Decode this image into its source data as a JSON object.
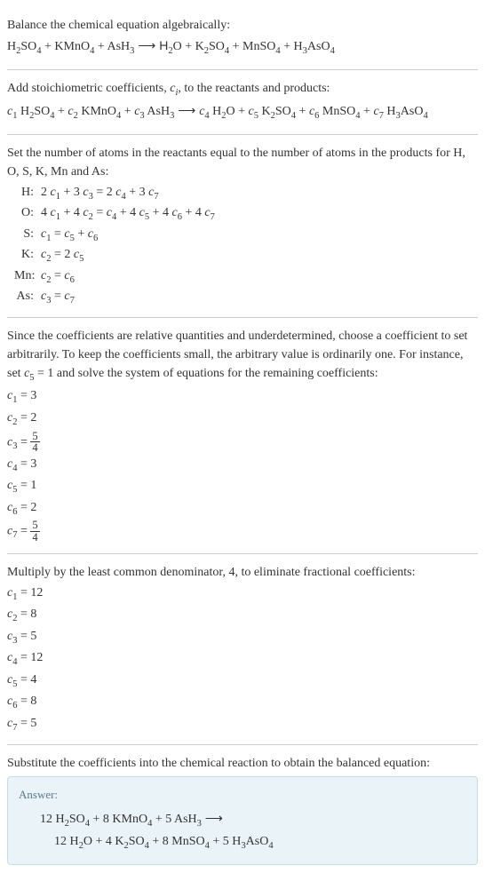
{
  "section1": {
    "line1": "Balance the chemical equation algebraically:",
    "line2_parts": [
      "H",
      "2",
      "SO",
      "4",
      " + KMnO",
      "4",
      " + AsH",
      "3",
      "  ⟶  H",
      "2",
      "O + K",
      "2",
      "SO",
      "4",
      " + MnSO",
      "4",
      " + H",
      "3",
      "AsO",
      "4"
    ]
  },
  "section2": {
    "line1_pre": "Add stoichiometric coefficients, ",
    "line1_ci": "c",
    "line1_i": "i",
    "line1_post": ", to the reactants and products:",
    "line2_parts": [
      "c",
      "1",
      " H",
      "2",
      "SO",
      "4",
      " + ",
      "c",
      "2",
      " KMnO",
      "4",
      " + ",
      "c",
      "3",
      " AsH",
      "3",
      "  ⟶  ",
      "c",
      "4",
      " H",
      "2",
      "O + ",
      "c",
      "5",
      " K",
      "2",
      "SO",
      "4",
      " + ",
      "c",
      "6",
      " MnSO",
      "4",
      " + ",
      "c",
      "7",
      " H",
      "3",
      "AsO",
      "4"
    ]
  },
  "section3": {
    "intro": "Set the number of atoms in the reactants equal to the number of atoms in the products for H, O, S, K, Mn and As:",
    "rows": [
      {
        "label": "H:",
        "eq_parts": [
          "2 ",
          "c",
          "1",
          " + 3 ",
          "c",
          "3",
          " = 2 ",
          "c",
          "4",
          " + 3 ",
          "c",
          "7"
        ]
      },
      {
        "label": "O:",
        "eq_parts": [
          "4 ",
          "c",
          "1",
          " + 4 ",
          "c",
          "2",
          " = ",
          "c",
          "4",
          " + 4 ",
          "c",
          "5",
          " + 4 ",
          "c",
          "6",
          " + 4 ",
          "c",
          "7"
        ]
      },
      {
        "label": "S:",
        "eq_parts": [
          "c",
          "1",
          " = ",
          "c",
          "5",
          " + ",
          "c",
          "6"
        ]
      },
      {
        "label": "K:",
        "eq_parts": [
          "c",
          "2",
          " = 2 ",
          "c",
          "5"
        ]
      },
      {
        "label": "Mn:",
        "eq_parts": [
          "c",
          "2",
          " = ",
          "c",
          "6"
        ]
      },
      {
        "label": "As:",
        "eq_parts": [
          "c",
          "3",
          " = ",
          "c",
          "7"
        ]
      }
    ]
  },
  "section4": {
    "intro_parts": [
      "Since the coefficients are relative quantities and underdetermined, choose a coefficient to set arbitrarily. To keep the coefficients small, the arbitrary value is ordinarily one. For instance, set ",
      "c",
      "5",
      " = 1 and solve the system of equations for the remaining coefficients:"
    ],
    "coeffs": [
      {
        "var": "c",
        "sub": "1",
        "val": "3",
        "frac": null
      },
      {
        "var": "c",
        "sub": "2",
        "val": "2",
        "frac": null
      },
      {
        "var": "c",
        "sub": "3",
        "val": null,
        "frac": {
          "num": "5",
          "den": "4"
        }
      },
      {
        "var": "c",
        "sub": "4",
        "val": "3",
        "frac": null
      },
      {
        "var": "c",
        "sub": "5",
        "val": "1",
        "frac": null
      },
      {
        "var": "c",
        "sub": "6",
        "val": "2",
        "frac": null
      },
      {
        "var": "c",
        "sub": "7",
        "val": null,
        "frac": {
          "num": "5",
          "den": "4"
        }
      }
    ]
  },
  "section5": {
    "intro": "Multiply by the least common denominator, 4, to eliminate fractional coefficients:",
    "coeffs": [
      {
        "var": "c",
        "sub": "1",
        "val": "12"
      },
      {
        "var": "c",
        "sub": "2",
        "val": "8"
      },
      {
        "var": "c",
        "sub": "3",
        "val": "5"
      },
      {
        "var": "c",
        "sub": "4",
        "val": "12"
      },
      {
        "var": "c",
        "sub": "5",
        "val": "4"
      },
      {
        "var": "c",
        "sub": "6",
        "val": "8"
      },
      {
        "var": "c",
        "sub": "7",
        "val": "5"
      }
    ]
  },
  "section6": {
    "intro": "Substitute the coefficients into the chemical reaction to obtain the balanced equation:",
    "answer_label": "Answer:",
    "answer_line1_parts": [
      "12 H",
      "2",
      "SO",
      "4",
      " + 8 KMnO",
      "4",
      " + 5 AsH",
      "3",
      "  ⟶"
    ],
    "answer_line2_parts": [
      "12 H",
      "2",
      "O + 4 K",
      "2",
      "SO",
      "4",
      " + 8 MnSO",
      "4",
      " + 5 H",
      "3",
      "AsO",
      "4"
    ]
  }
}
